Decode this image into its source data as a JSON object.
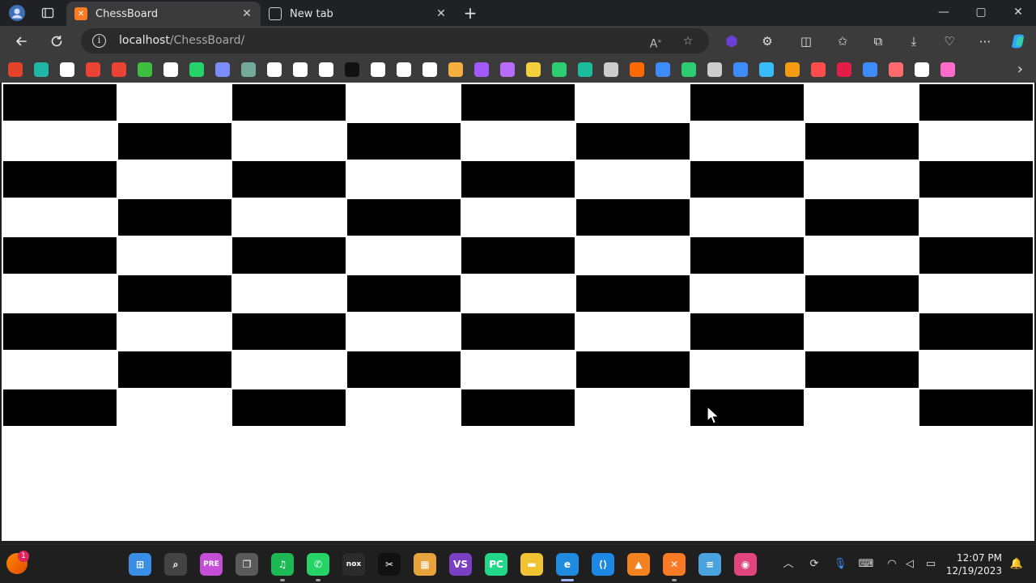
{
  "browser": {
    "tabs": [
      {
        "label": "ChessBoard",
        "favicon": "xampp-icon",
        "active": true
      },
      {
        "label": "New tab",
        "favicon": "newtab-icon",
        "active": false
      }
    ],
    "address": {
      "host": "localhost",
      "path": "/ChessBoard/"
    },
    "new_tab_glyph": "+",
    "window_controls": {
      "minimize": "—",
      "maximize": "▢",
      "close": "✕"
    }
  },
  "bookmarks_bar": {
    "items": [
      {
        "icon": "git-icon",
        "color": "#e24329"
      },
      {
        "icon": "diamond-icon",
        "color": "#1fb6a6"
      },
      {
        "icon": "github-icon",
        "color": "#ffffff"
      },
      {
        "icon": "gmail-icon",
        "color": "#ea4335"
      },
      {
        "icon": "gmail-icon",
        "color": "#ea4335"
      },
      {
        "icon": "star-icon",
        "color": "#3fbf3f"
      },
      {
        "icon": "google-icon",
        "color": "#ffffff"
      },
      {
        "icon": "whatsapp-icon",
        "color": "#25d366"
      },
      {
        "icon": "gemini-icon",
        "color": "#7b8cff"
      },
      {
        "icon": "chatgpt-icon",
        "color": "#74aa9c"
      },
      {
        "icon": "threads-icon",
        "color": "#ffffff"
      },
      {
        "icon": "p-icon",
        "color": "#ffffff"
      },
      {
        "icon": "c-icon",
        "color": "#ffffff"
      },
      {
        "icon": "triangle-icon",
        "color": "#111111"
      },
      {
        "icon": "notion-icon",
        "color": "#ffffff"
      },
      {
        "icon": "coffee-icon",
        "color": "#ffffff"
      },
      {
        "icon": "framer-icon",
        "color": "#ffffff"
      },
      {
        "icon": "bull-icon",
        "color": "#f4b03e"
      },
      {
        "icon": "figma-icon",
        "color": "#a259ff"
      },
      {
        "icon": "sparkle-icon",
        "color": "#b86bff"
      },
      {
        "icon": "z-icon",
        "color": "#f4d03f"
      },
      {
        "icon": "f-icon",
        "color": "#2ecc71"
      },
      {
        "icon": "w-icon",
        "color": "#1abc9c"
      },
      {
        "icon": "gvc-icon",
        "color": "#cccccc"
      },
      {
        "icon": "square-icon",
        "color": "#ff6a00"
      },
      {
        "icon": "gear-icon",
        "color": "#3d8bfd"
      },
      {
        "icon": "leaf-icon",
        "color": "#2ecc71"
      },
      {
        "icon": "car-icon",
        "color": "#cccccc"
      },
      {
        "icon": "bing-icon",
        "color": "#3d8bfd"
      },
      {
        "icon": "tailwind-icon",
        "color": "#38bdf8"
      },
      {
        "icon": "chevron-icon",
        "color": "#f39c12"
      },
      {
        "icon": "ring-icon",
        "color": "#ff4d4d"
      },
      {
        "icon": "d-icon",
        "color": "#e11d48"
      },
      {
        "icon": "a-icon",
        "color": "#3d8bfd"
      },
      {
        "icon": "puzzle-icon",
        "color": "#ff6b6b"
      },
      {
        "icon": "brush-icon",
        "color": "#ffffff"
      },
      {
        "icon": "palette-icon",
        "color": "#ff6bcb"
      }
    ]
  },
  "page": {
    "board": {
      "rows": 9,
      "cols": 9,
      "dark_color": "#000000",
      "light_color": "#ffffff"
    }
  },
  "taskbar": {
    "apps": [
      {
        "name": "start-icon",
        "label": "⊞",
        "color": "#3a8ee6"
      },
      {
        "name": "search-icon",
        "label": "⌕",
        "color": "#444444"
      },
      {
        "name": "copilot-icon",
        "label": "PRE",
        "color": "#c44fd6"
      },
      {
        "name": "task-view-icon",
        "label": "❐",
        "color": "#5a5a5a"
      },
      {
        "name": "spotify-icon",
        "label": "♫",
        "color": "#1db954"
      },
      {
        "name": "whatsapp-icon",
        "label": "✆",
        "color": "#25d366"
      },
      {
        "name": "nox-icon",
        "label": "nox",
        "color": "#2b2b2b"
      },
      {
        "name": "capcut-icon",
        "label": "✂",
        "color": "#111111"
      },
      {
        "name": "store-icon",
        "label": "▦",
        "color": "#e8a33d"
      },
      {
        "name": "visual-studio-icon",
        "label": "VS",
        "color": "#7b3fc4"
      },
      {
        "name": "pycharm-icon",
        "label": "PC",
        "color": "#21d789"
      },
      {
        "name": "file-explorer-icon",
        "label": "▬",
        "color": "#f1c232"
      },
      {
        "name": "edge-icon",
        "label": "e",
        "color": "#1f8be0"
      },
      {
        "name": "vscode-icon",
        "label": "⟨⟩",
        "color": "#1e88e5"
      },
      {
        "name": "vlc-icon",
        "label": "▲",
        "color": "#f58220"
      },
      {
        "name": "xampp-icon",
        "label": "✕",
        "color": "#fb7a24"
      },
      {
        "name": "notepad-icon",
        "label": "≡",
        "color": "#4aa3df"
      },
      {
        "name": "photos-icon",
        "label": "◉",
        "color": "#e0457b"
      }
    ],
    "time": "12:07 PM",
    "date": "12/19/2023",
    "notification_badge": "1"
  }
}
